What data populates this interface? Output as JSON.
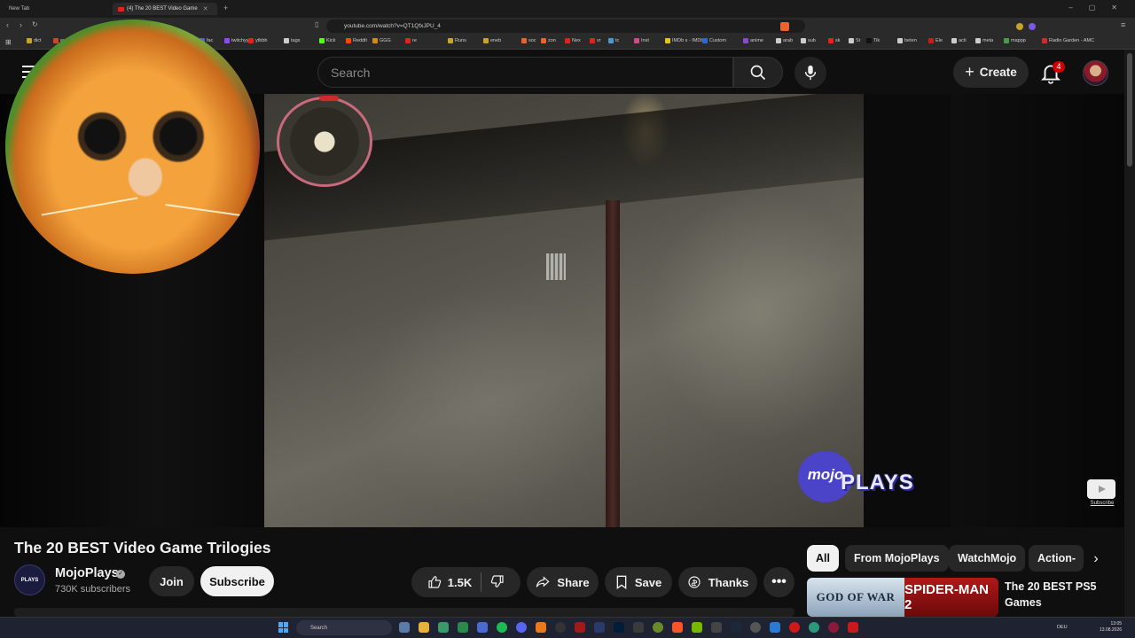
{
  "browser": {
    "tabs": [
      {
        "label": "New Tab",
        "active": false
      },
      {
        "label": "(4) The 20 BEST Video Game",
        "active": true
      }
    ],
    "url": "youtube.com/watch?v=QT1QfxJPU_4",
    "bookmarks": [
      "dict",
      "was",
      "fac",
      "twitchyy",
      "ytbbb",
      "tags",
      "Kick",
      "Reddit",
      "GGG",
      "re",
      "Runs",
      "eneb",
      "soc",
      "zon",
      "Nex",
      "vr",
      "tc",
      "Inst",
      "IMDb s - IMDb",
      "Custom",
      "anime",
      "arab",
      "sub",
      "sk",
      "St",
      "Tik",
      "beten",
      "Ele",
      "acti",
      "meta",
      "mappp",
      "Radio Garden - AMC"
    ]
  },
  "header": {
    "search_placeholder": "Search",
    "create_label": "Create",
    "notification_count": "4"
  },
  "player": {
    "logo_text_1": "mojo",
    "logo_text_2": "PLAYS",
    "subscribe_watermark": "Subscribe"
  },
  "video": {
    "title": "The 20 BEST Video Game Trilogies",
    "channel_name": "MojoPlays",
    "channel_avatar_text": "PLAYS",
    "subscribers": "730K subscribers",
    "join_label": "Join",
    "subscribe_label": "Subscribe",
    "likes": "1.5K",
    "share_label": "Share",
    "save_label": "Save",
    "thanks_label": "Thanks"
  },
  "sidebar": {
    "chips": [
      "All",
      "From MojoPlays",
      "WatchMojo",
      "Action-"
    ],
    "recommendation": {
      "title": "The 20 BEST PS5 Games",
      "thumb_left": "GOD OF WAR",
      "thumb_right": "SPIDER-MAN 2"
    }
  },
  "taskbar": {
    "search_label": "Search",
    "language": "DEU",
    "time": "13:05",
    "date": "13.08.2026"
  }
}
